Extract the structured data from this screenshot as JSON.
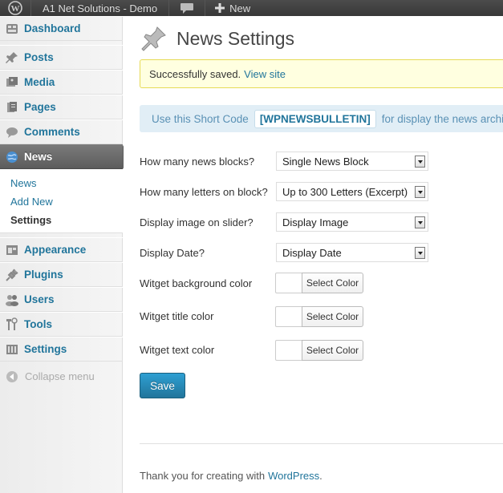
{
  "adminbar": {
    "site_name": "A1 Net Solutions - Demo",
    "new_label": "New"
  },
  "sidebar": {
    "items": [
      {
        "label": "Dashboard",
        "icon": "dashboard-icon"
      },
      {
        "label": "Posts",
        "icon": "pushpin-icon"
      },
      {
        "label": "Media",
        "icon": "media-icon"
      },
      {
        "label": "Pages",
        "icon": "pages-icon"
      },
      {
        "label": "Comments",
        "icon": "comment-icon"
      },
      {
        "label": "News",
        "icon": "globe-icon"
      },
      {
        "label": "Appearance",
        "icon": "appearance-icon"
      },
      {
        "label": "Plugins",
        "icon": "plug-icon"
      },
      {
        "label": "Users",
        "icon": "users-icon"
      },
      {
        "label": "Tools",
        "icon": "tools-icon"
      },
      {
        "label": "Settings",
        "icon": "settings-icon"
      }
    ],
    "submenu": [
      "News",
      "Add New",
      "Settings"
    ],
    "collapse_label": "Collapse menu"
  },
  "page": {
    "title": "News Settings",
    "notice_text": "Successfully saved.",
    "notice_link": "View site",
    "shortcode_prefix": "Use this Short Code",
    "shortcode": "[WPNEWSBULLETIN]",
    "shortcode_suffix": "for display the news archive/se"
  },
  "form": {
    "fields": [
      {
        "label": "How many news blocks?",
        "value": "Single News Block"
      },
      {
        "label": "How many letters on block?",
        "value": "Up to 300 Letters (Excerpt)"
      },
      {
        "label": "Display image on slider?",
        "value": "Display Image"
      },
      {
        "label": "Display Date?",
        "value": "Display Date"
      }
    ],
    "colors": [
      {
        "label": "Witget background color",
        "button": "Select Color"
      },
      {
        "label": "Witget title color",
        "button": "Select Color"
      },
      {
        "label": "Witget text color",
        "button": "Select Color"
      }
    ],
    "save_label": "Save"
  },
  "footer": {
    "text": "Thank you for creating with",
    "link": "WordPress",
    "end": "."
  }
}
